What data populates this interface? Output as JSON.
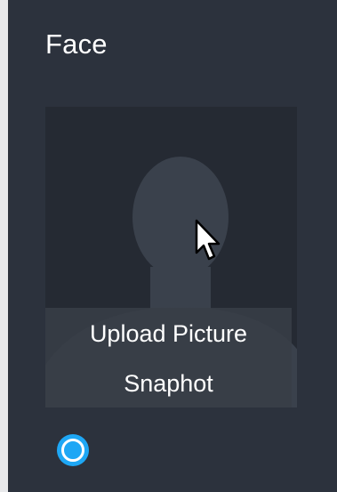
{
  "section": {
    "title": "Face"
  },
  "photo": {
    "upload_label": "Upload Picture",
    "snapshot_label": "Snaphot"
  },
  "icons": {
    "face_icon": "face-recognition-icon",
    "cursor": "mouse-pointer-icon",
    "placeholder": "person-silhouette-icon"
  },
  "colors": {
    "panel_bg": "#2c323d",
    "photo_bg": "#252a33",
    "silhouette": "#3a414c",
    "accent": "#1ea7f5",
    "text": "#ffffff"
  }
}
